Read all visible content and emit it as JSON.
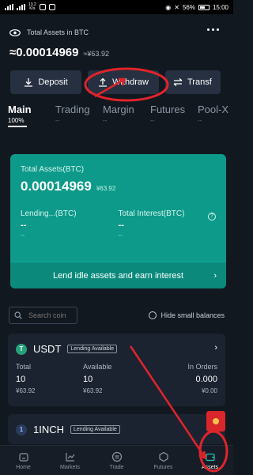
{
  "status_bar": {
    "left_speed_top": "13.2",
    "left_speed_bottom": "K/s",
    "battery_pct": "56%",
    "time": "15:00"
  },
  "header": {
    "total_label": "Total Assets in BTC",
    "balance_btc": "≈0.00014969",
    "balance_cny": "≈¥63.92"
  },
  "actions": {
    "deposit": "Deposit",
    "withdraw": "Withdraw",
    "transfer": "Transf"
  },
  "tabs": [
    {
      "label": "Main",
      "sub": "100%"
    },
    {
      "label": "Trading",
      "sub": "--"
    },
    {
      "label": "Margin",
      "sub": "--"
    },
    {
      "label": "Futures",
      "sub": "--"
    },
    {
      "label": "Pool-X",
      "sub": "--"
    }
  ],
  "card": {
    "title": "Total Assets(BTC)",
    "value": "0.00014969",
    "value_cny": "¥63.92",
    "lending_label": "Lending...(BTC)",
    "lending_val": "--",
    "lending_sub": "--",
    "interest_label": "Total Interest(BTC)",
    "interest_val": "--",
    "interest_sub": "--",
    "footer": "Lend idle assets and earn interest"
  },
  "search": {
    "placeholder": "Search coin",
    "hide_small": "Hide small balances"
  },
  "coins": [
    {
      "name": "USDT",
      "badge": "Lending Available",
      "total_label": "Total",
      "total_val": "10",
      "total_cny": "¥63.92",
      "avail_label": "Available",
      "avail_val": "10",
      "avail_cny": "¥63.92",
      "orders_label": "In Orders",
      "orders_val": "0.000",
      "orders_cny": "¥0.00"
    },
    {
      "name": "1INCH",
      "badge": "Lending Available"
    }
  ],
  "nav": {
    "home": "Home",
    "markets": "Markets",
    "trade": "Trade",
    "futures": "Futures",
    "assets": "Assets"
  },
  "colors": {
    "accent_green": "#0d9a8a",
    "annotation_red": "#e0242b",
    "background": "#121820"
  }
}
